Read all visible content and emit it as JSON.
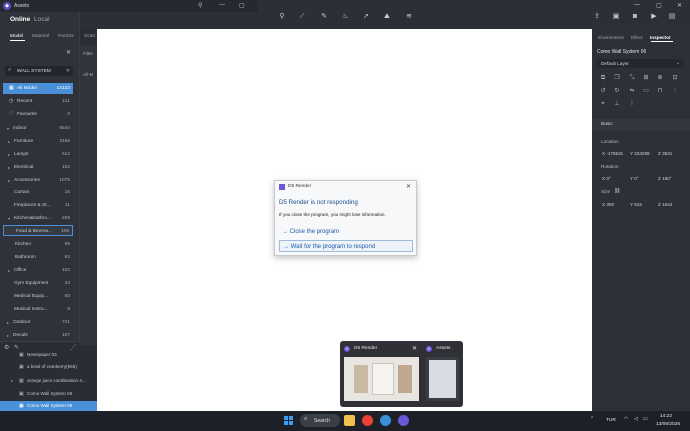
{
  "assets_window": {
    "title": "Assets",
    "segments": [
      "Online",
      "Local"
    ],
    "tabs": [
      "Model",
      "Material",
      "Particle",
      "Scatt"
    ],
    "search_value": "WALL SYSTEM",
    "tree": [
      {
        "label": "All Model",
        "count": "14123"
      },
      {
        "label": "Recent",
        "count": "121"
      },
      {
        "label": "Favourite",
        "count": "0"
      },
      {
        "label": "Indoor",
        "count": "5544"
      },
      {
        "label": "Furniture",
        "count": "3166"
      },
      {
        "label": "Lamps",
        "count": "612"
      },
      {
        "label": "Electrical",
        "count": "152"
      },
      {
        "label": "Accessories",
        "count": "1075"
      },
      {
        "label": "Curtain",
        "count": "15"
      },
      {
        "label": "Fireplaces & St...",
        "count": "11"
      },
      {
        "label": "Kitchen&bathro...",
        "count": "259"
      },
      {
        "label": "Food & Bevera...",
        "count": "108"
      },
      {
        "label": "Kitchen",
        "count": "89"
      },
      {
        "label": "Bathroom",
        "count": "62"
      },
      {
        "label": "Office",
        "count": "102"
      },
      {
        "label": "Gym Equipment",
        "count": "34"
      },
      {
        "label": "Medical Equip...",
        "count": "50"
      },
      {
        "label": "Musical Instru...",
        "count": "8"
      },
      {
        "label": "Outdoor",
        "count": "721"
      },
      {
        "label": "Decals",
        "count": "167"
      }
    ]
  },
  "left_panel": {
    "filter_label": "Filter",
    "all_label": "All-M",
    "scene_items": [
      "Newspaper 03",
      "a bowl of cranberry(555)",
      "orange juice combination 4...",
      "Como Wall System 06",
      "Como Wall System 06"
    ]
  },
  "inspector": {
    "tabs": [
      "Environment",
      "Effect",
      "Inspector"
    ],
    "object_name": "Como Wall System 06",
    "layer": "Default Layer",
    "section_basic": "Basic",
    "location_label": "Location",
    "location": {
      "x": "X -175531",
      "y": "Y 234289",
      "z": "Z 3631"
    },
    "rotation_label": "Rotation",
    "rotation": {
      "x": "X 0°",
      "y": "Y 0°",
      "z": "Z 180°"
    },
    "size_label": "Size",
    "size": {
      "x": "X 300",
      "y": "Y 615",
      "z": "Z 1644"
    }
  },
  "dialog": {
    "title": "D5 Render",
    "heading": "D5 Render is not responding",
    "message": "If you close the program, you might lose information.",
    "option_close": "→ Close the program",
    "option_wait": "→ Wait for the program to respond"
  },
  "taskbar_preview": {
    "app1": "D5 Render",
    "app2": "Assets"
  },
  "taskbar": {
    "search": "Search",
    "lang": "TUR",
    "time": "14:22",
    "date": "13/06/2026"
  },
  "colors": {
    "accent": "#4a90d9",
    "dialog_link": "#1b5aa8",
    "panel_bg": "#2d3037"
  }
}
